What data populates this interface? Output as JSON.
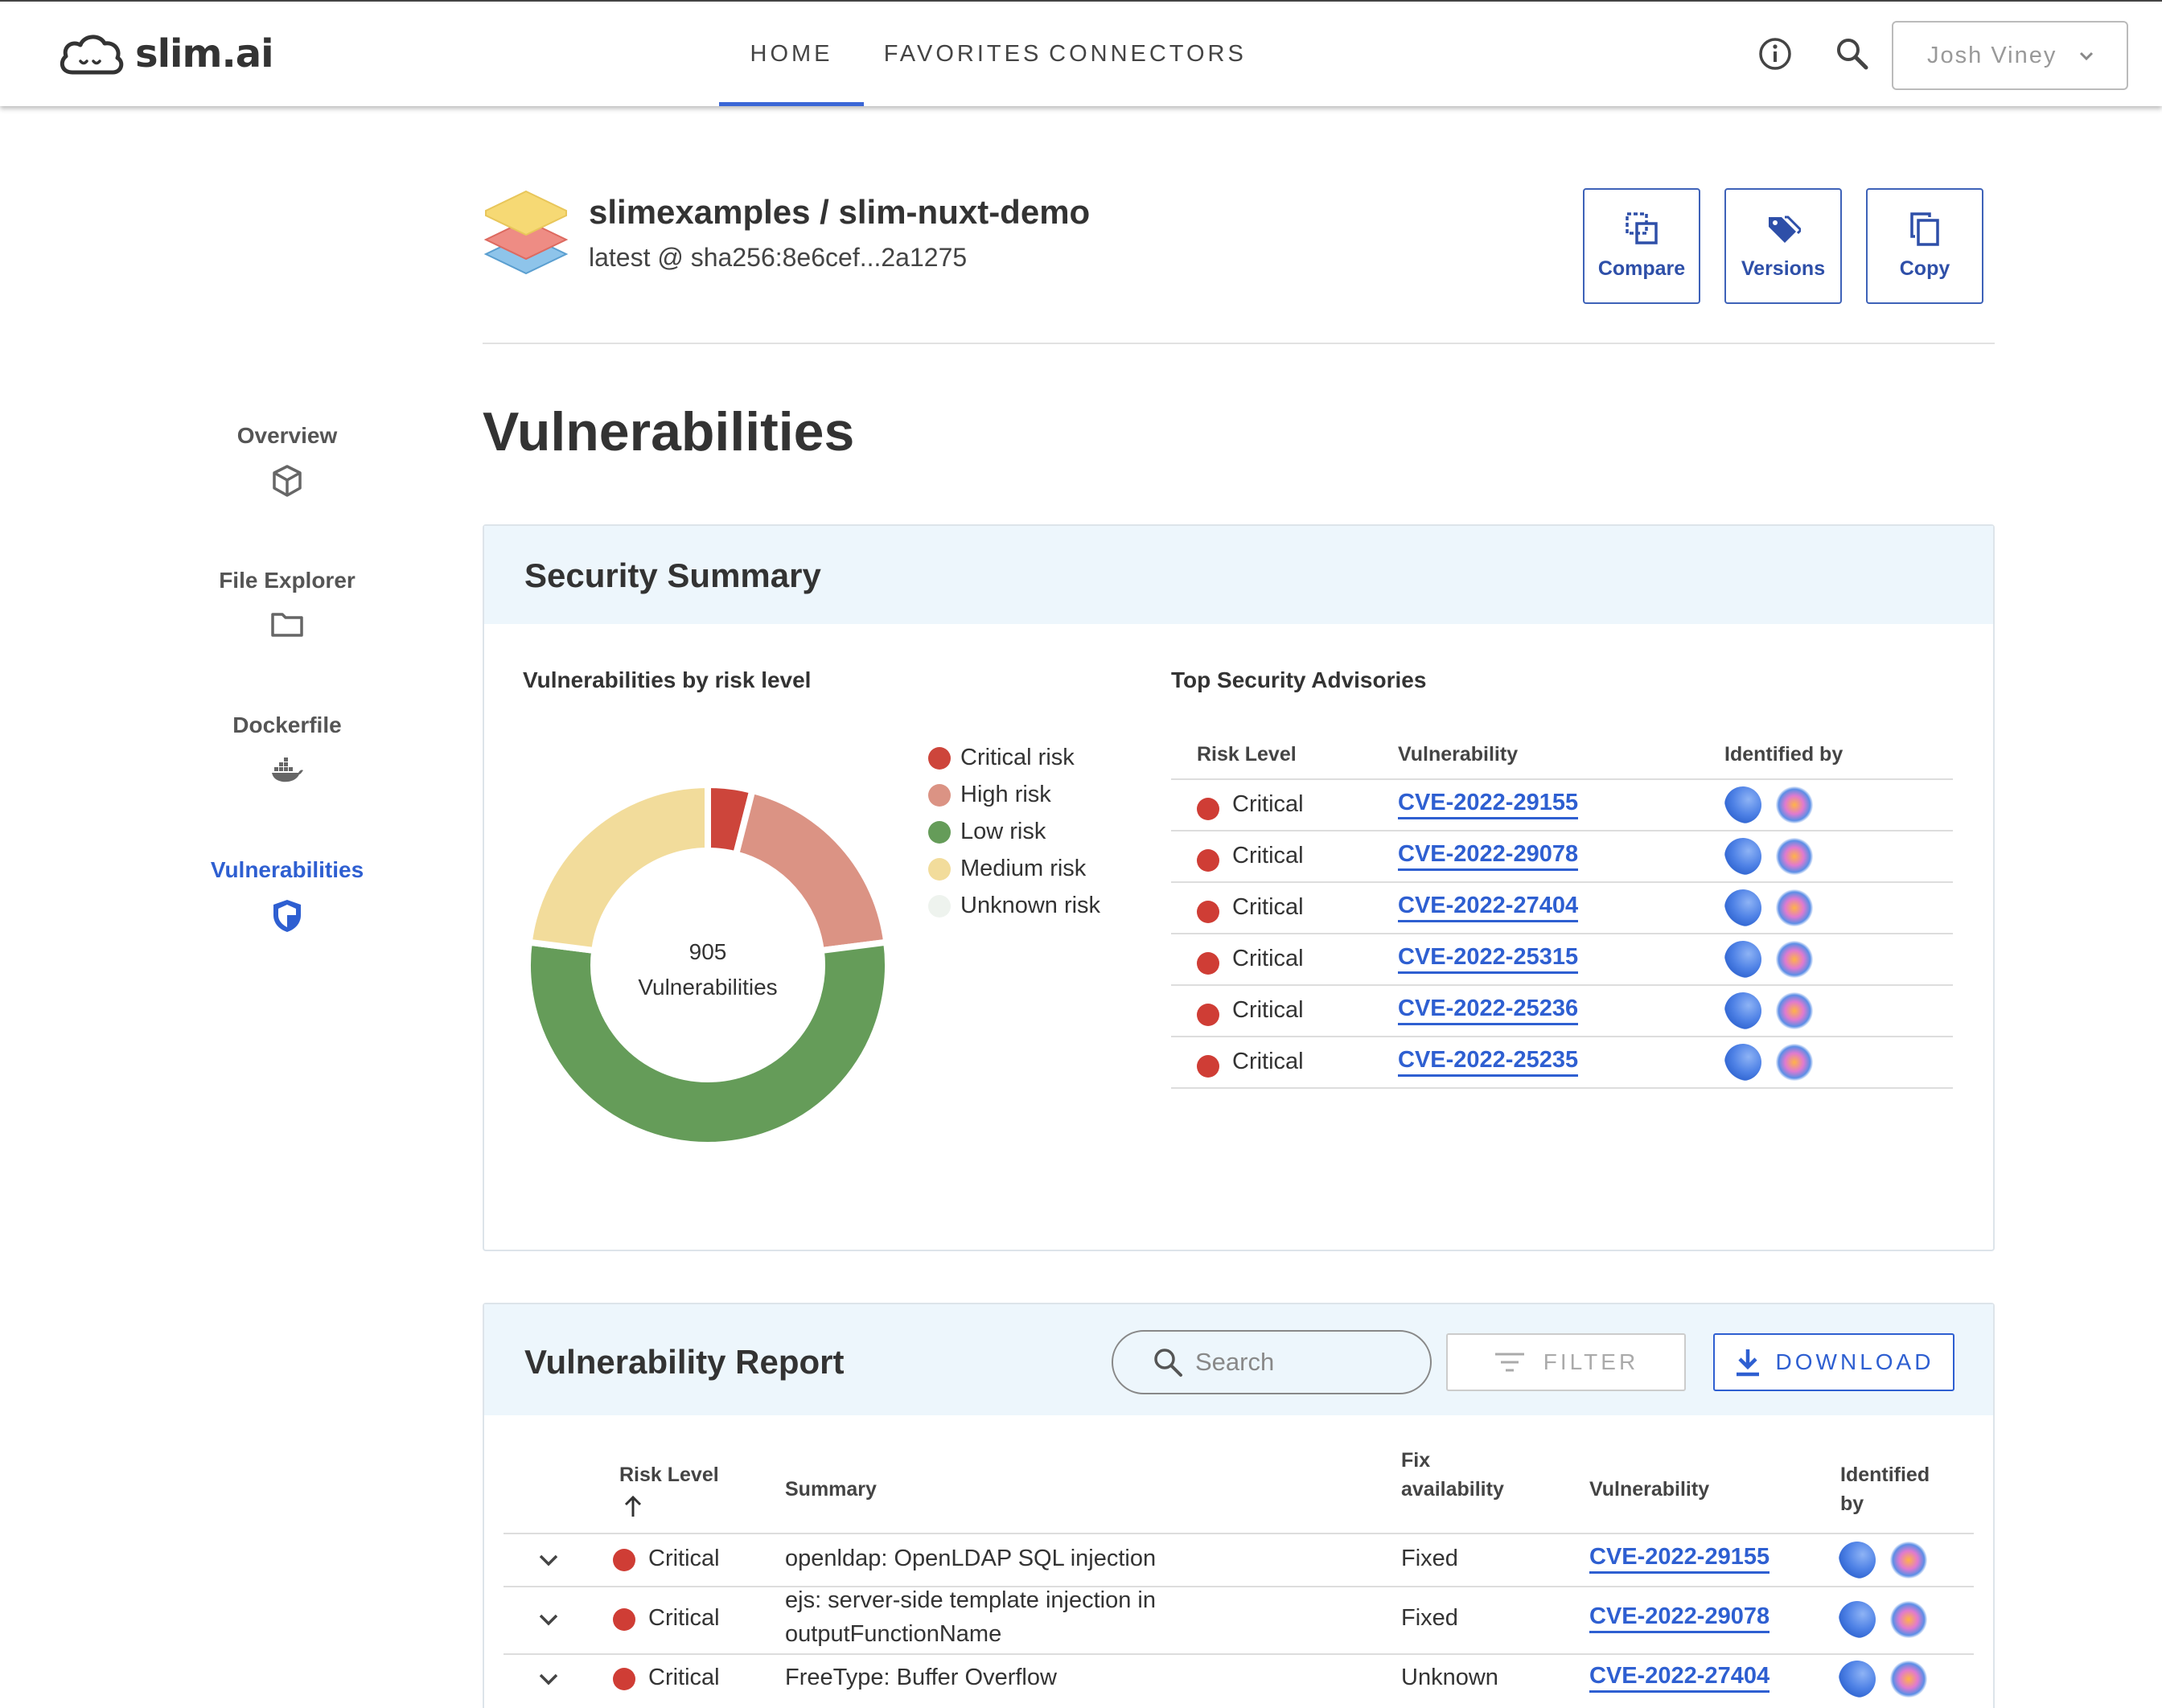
{
  "app": {
    "brand": "slim.ai",
    "nav": [
      {
        "label": "HOME",
        "active": true
      },
      {
        "label": "FAVORITES",
        "active": false
      },
      {
        "label": "CONNECTORS",
        "active": false
      }
    ],
    "user": "Josh Viney"
  },
  "sidebar": {
    "items": [
      {
        "label": "Overview",
        "icon": "cube-icon",
        "active": false
      },
      {
        "label": "File Explorer",
        "icon": "folder-icon",
        "active": false
      },
      {
        "label": "Dockerfile",
        "icon": "docker-whale-icon",
        "active": false
      },
      {
        "label": "Vulnerabilities",
        "icon": "shield-icon",
        "active": true
      }
    ]
  },
  "repo": {
    "name": "slimexamples / slim-nuxt-demo",
    "tag": "latest @ sha256:8e6cef...2a1275",
    "actions": [
      "Compare",
      "Versions",
      "Copy"
    ]
  },
  "page_title": "Vulnerabilities",
  "summary": {
    "title": "Security Summary",
    "chart_title": "Vulnerabilities by risk level",
    "center_count": "905",
    "center_label": "Vulnerabilities",
    "advisories_title": "Top Security Advisories",
    "advisories_headers": [
      "Risk Level",
      "Vulnerability",
      "Identified by"
    ],
    "advisories": [
      {
        "risk": "Critical",
        "cve": "CVE-2022-29155"
      },
      {
        "risk": "Critical",
        "cve": "CVE-2022-29078"
      },
      {
        "risk": "Critical",
        "cve": "CVE-2022-27404"
      },
      {
        "risk": "Critical",
        "cve": "CVE-2022-25315"
      },
      {
        "risk": "Critical",
        "cve": "CVE-2022-25236"
      },
      {
        "risk": "Critical",
        "cve": "CVE-2022-25235"
      }
    ]
  },
  "chart_data": {
    "type": "pie",
    "donut": true,
    "title": "Vulnerabilities by risk level",
    "total": 905,
    "legend_position": "right",
    "categories": [
      "Critical risk",
      "High risk",
      "Low risk",
      "Medium risk",
      "Unknown risk"
    ],
    "values": [
      36,
      172,
      489,
      208,
      0
    ],
    "colors": [
      "#cd453b",
      "#db9384",
      "#659c59",
      "#f2dc9b",
      "#eef3ee"
    ]
  },
  "report": {
    "title": "Vulnerability Report",
    "search_placeholder": "Search",
    "filter_label": "FILTER",
    "download_label": "DOWNLOAD",
    "headers": {
      "risk": "Risk Level",
      "summary": "Summary",
      "fix_line1": "Fix",
      "fix_line2": "availability",
      "vulnerability": "Vulnerability",
      "identified_line1": "Identified",
      "identified_line2": "by"
    },
    "rows": [
      {
        "risk": "Critical",
        "summary_line1": "openldap: OpenLDAP SQL injection",
        "summary_line2": "",
        "fix": "Fixed",
        "cve": "CVE-2022-29155"
      },
      {
        "risk": "Critical",
        "summary_line1": "ejs: server-side template injection in",
        "summary_line2": "outputFunctionName",
        "fix": "Fixed",
        "cve": "CVE-2022-29078"
      },
      {
        "risk": "Critical",
        "summary_line1": "FreeType: Buffer Overflow",
        "summary_line2": "",
        "fix": "Unknown",
        "cve": "CVE-2022-27404"
      }
    ]
  }
}
